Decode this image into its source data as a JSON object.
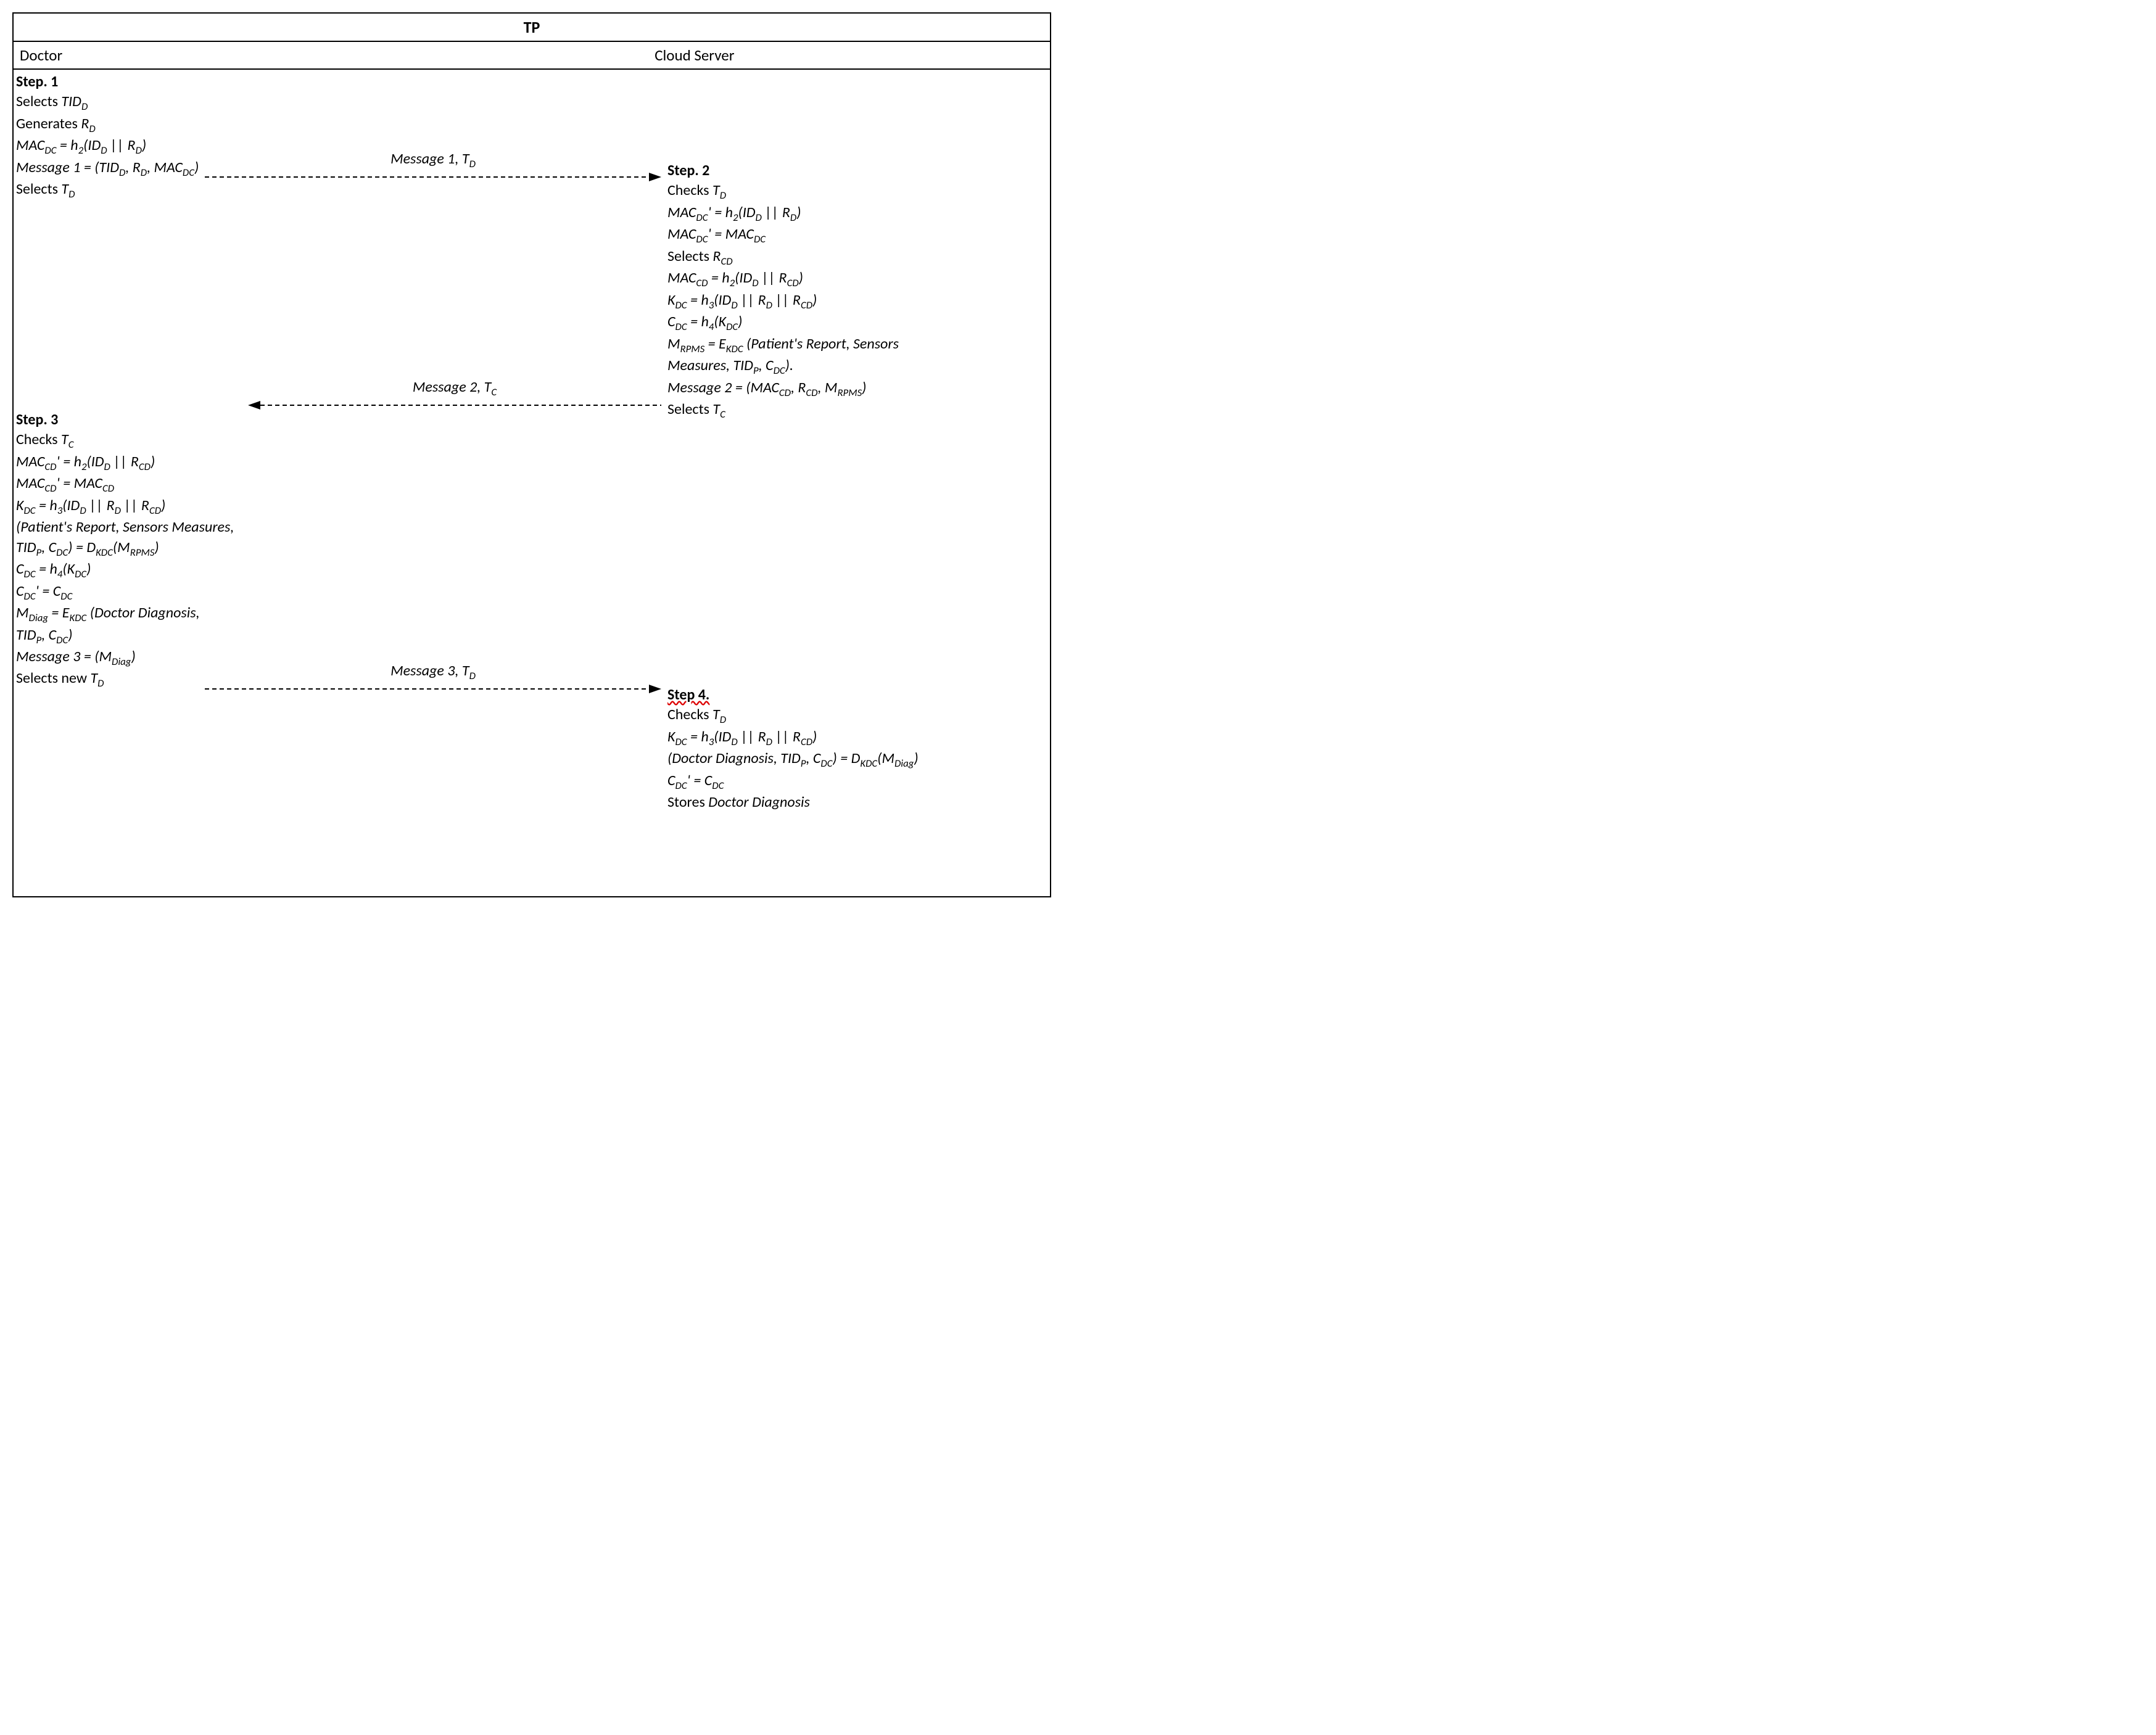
{
  "title": "TP",
  "headers": {
    "left": "Doctor",
    "right": "Cloud Server"
  },
  "arrows": {
    "m1": "Message 1, T",
    "m1_sub": "D",
    "m2": "Message 2, T",
    "m2_sub": "C",
    "m3": "Message 3, T",
    "m3_sub": "D"
  },
  "step1": {
    "title": "Step. 1",
    "l1_a": "Selects ",
    "l1_b": "TID",
    "l1_sub": "D",
    "l2_a": "Generates ",
    "l2_b": "R",
    "l2_sub": "D",
    "l3": "MAC",
    "l3_sub": "DC",
    "l3_b": " = h",
    "l3_sub2": "2",
    "l3_c": "(ID",
    "l3_sub3": "D",
    "l3_d": " || R",
    "l3_sub4": "D",
    "l3_e": ")",
    "l4": "Message 1 = (TID",
    "l4_sub": "D",
    "l4_b": ", R",
    "l4_sub2": "D",
    "l4_c": ", MAC",
    "l4_sub3": "DC",
    "l4_d": ")",
    "l5_a": "Selects ",
    "l5_b": "T",
    "l5_sub": "D"
  },
  "step2": {
    "title": "Step. 2",
    "l1_a": "Checks ",
    "l1_b": "T",
    "l1_sub": "D",
    "l2": "MAC",
    "l2_sub": "DC",
    "l2_b": "' = h",
    "l2_sub2": "2",
    "l2_c": "(ID",
    "l2_sub3": "D",
    "l2_d": " || R",
    "l2_sub4": "D",
    "l2_e": ")",
    "l3": "MAC",
    "l3_sub": "DC",
    "l3_b": "' = MAC",
    "l3_sub2": "DC",
    "l4_a": "Selects ",
    "l4_b": "R",
    "l4_sub": "CD",
    "l5": "MAC",
    "l5_sub": "CD",
    "l5_b": " = h",
    "l5_sub2": "2",
    "l5_c": "(ID",
    "l5_sub3": "D",
    "l5_d": " || R",
    "l5_sub4": "CD",
    "l5_e": ")",
    "l6": "K",
    "l6_sub": "DC",
    "l6_b": " = h",
    "l6_sub2": "3",
    "l6_c": "(ID",
    "l6_sub3": "D",
    "l6_d": " || R",
    "l6_sub4": "D",
    "l6_e": " || R",
    "l6_sub5": "CD",
    "l6_f": ")",
    "l7": "C",
    "l7_sub": "DC",
    "l7_b": " = h",
    "l7_sub2": "4",
    "l7_c": "(K",
    "l7_sub3": "DC",
    "l7_d": ")",
    "l8": "M",
    "l8_sub": "RPMS",
    "l8_b": " = E",
    "l8_sub2": "KDC",
    "l8_c": " (Patient's Report, Sensors",
    "l9": "Measures, TID",
    "l9_sub": "P",
    "l9_b": ", C",
    "l9_sub2": "DC",
    "l9_c": ").",
    "l10": "Message 2 = (MAC",
    "l10_sub": "CD",
    "l10_b": ", R",
    "l10_sub2": "CD",
    "l10_c": ", M",
    "l10_sub3": "RPMS",
    "l10_d": ")",
    "l11_a": "Selects ",
    "l11_b": "T",
    "l11_sub": "C"
  },
  "step3": {
    "title": "Step. 3",
    "l1_a": "Checks ",
    "l1_b": "T",
    "l1_sub": "C",
    "l2": "MAC",
    "l2_sub": "CD",
    "l2_b": "' = h",
    "l2_sub2": "2",
    "l2_c": "(ID",
    "l2_sub3": "D",
    "l2_d": " || R",
    "l2_sub4": "CD",
    "l2_e": ")",
    "l3": "MAC",
    "l3_sub": "CD",
    "l3_b": "' = MAC",
    "l3_sub2": "CD",
    "l4": "K",
    "l4_sub": "DC",
    "l4_b": " = h",
    "l4_sub2": "3",
    "l4_c": "(ID",
    "l4_sub3": "D",
    "l4_d": " || R",
    "l4_sub4": "D",
    "l4_e": " || R",
    "l4_sub5": "CD",
    "l4_f": ")",
    "l5": "(Patient's Report, Sensors Measures,",
    "l6": " TID",
    "l6_sub": "P",
    "l6_b": ", C",
    "l6_sub2": "DC",
    "l6_c": ") = D",
    "l6_sub3": "KDC",
    "l6_d": "(M",
    "l6_sub4": "RPMS",
    "l6_e": ")",
    "l7": "C",
    "l7_sub": "DC",
    "l7_b": " = h",
    "l7_sub2": "4",
    "l7_c": "(K",
    "l7_sub3": "DC",
    "l7_d": ")",
    "l8": "C",
    "l8_sub": "DC",
    "l8_b": "' = C",
    "l8_sub2": "DC",
    "l9": "M",
    "l9_sub": "Diag",
    "l9_b": " = E",
    "l9_sub2": "KDC",
    "l9_c": " (Doctor Diagnosis,",
    "l10": " TID",
    "l10_sub": "P",
    "l10_b": ", C",
    "l10_sub2": "DC",
    "l10_c": ")",
    "l11": "Message 3 = (M",
    "l11_sub": "Diag",
    "l11_b": ")",
    "l12_a": "Selects new ",
    "l12_b": "T",
    "l12_sub": "D"
  },
  "step4": {
    "title": "Step 4.",
    "l1_a": "Checks ",
    "l1_b": "T",
    "l1_sub": "D",
    "l2": "K",
    "l2_sub": "DC",
    "l2_b": " = h",
    "l2_sub2": "3",
    "l2_c": "(ID",
    "l2_sub3": "D",
    "l2_d": " || R",
    "l2_sub4": "D",
    "l2_e": " || R",
    "l2_sub5": "CD",
    "l2_f": ")",
    "l3": "(Doctor Diagnosis, TID",
    "l3_sub": "P",
    "l3_b": ", C",
    "l3_sub2": "DC",
    "l3_c": ") = D",
    "l3_sub3": "KDC",
    "l3_d": "(M",
    "l3_sub4": "Diag",
    "l3_e": ")",
    "l4": "C",
    "l4_sub": "DC",
    "l4_b": "' = C",
    "l4_sub2": "DC",
    "l5_a": "Stores ",
    "l5_b": "Doctor Diagnosis"
  }
}
